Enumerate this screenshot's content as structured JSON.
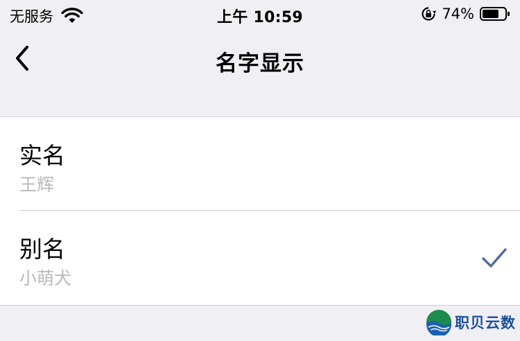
{
  "status_bar": {
    "carrier": "无服务",
    "time": "上午 10:59",
    "battery_percent": "74%",
    "battery_level": 0.74,
    "icons": [
      "wifi-icon",
      "rotation-lock-icon",
      "battery-icon"
    ]
  },
  "nav": {
    "title": "名字显示",
    "back_icon": "chevron-left-icon"
  },
  "options": [
    {
      "title": "实名",
      "subtitle": "王辉",
      "selected": false
    },
    {
      "title": "别名",
      "subtitle": "小萌犬",
      "selected": true
    }
  ],
  "colors": {
    "background": "#efeff4",
    "checkmark": "#4a6f9a",
    "subtitle": "#b9b9bd"
  },
  "watermark": {
    "text": "职贝云数"
  }
}
